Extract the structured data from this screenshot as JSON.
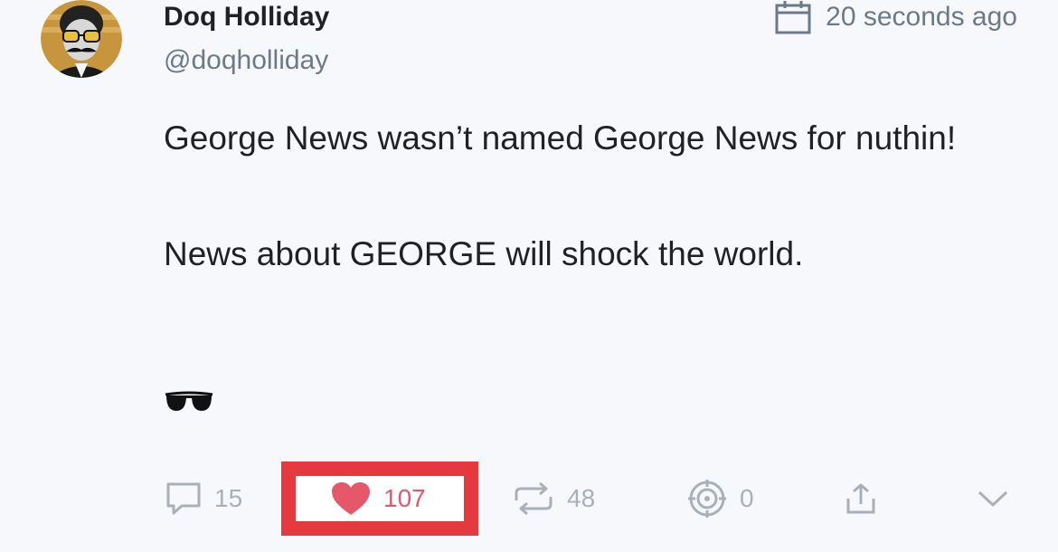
{
  "author": {
    "name": "Doq Holliday",
    "handle": "@doqholliday"
  },
  "timestamp": "20 seconds ago",
  "body": {
    "line1": "George News wasn’t named George News for nuthin!",
    "line2": "News about GEORGE will shock the world."
  },
  "actions": {
    "comments": "15",
    "likes": "107",
    "reposts": "48",
    "target": "0"
  },
  "colors": {
    "like_red": "#e5586a",
    "highlight_border": "#e5383f",
    "muted_icon": "#a9b0b8"
  },
  "icons": {
    "timestamp": "calendar-icon",
    "comments": "comment-icon",
    "likes": "heart-icon",
    "reposts": "repost-icon",
    "target": "target-icon",
    "share": "share-icon",
    "more": "chevron-down-icon",
    "emoji": "sunglasses-icon"
  }
}
